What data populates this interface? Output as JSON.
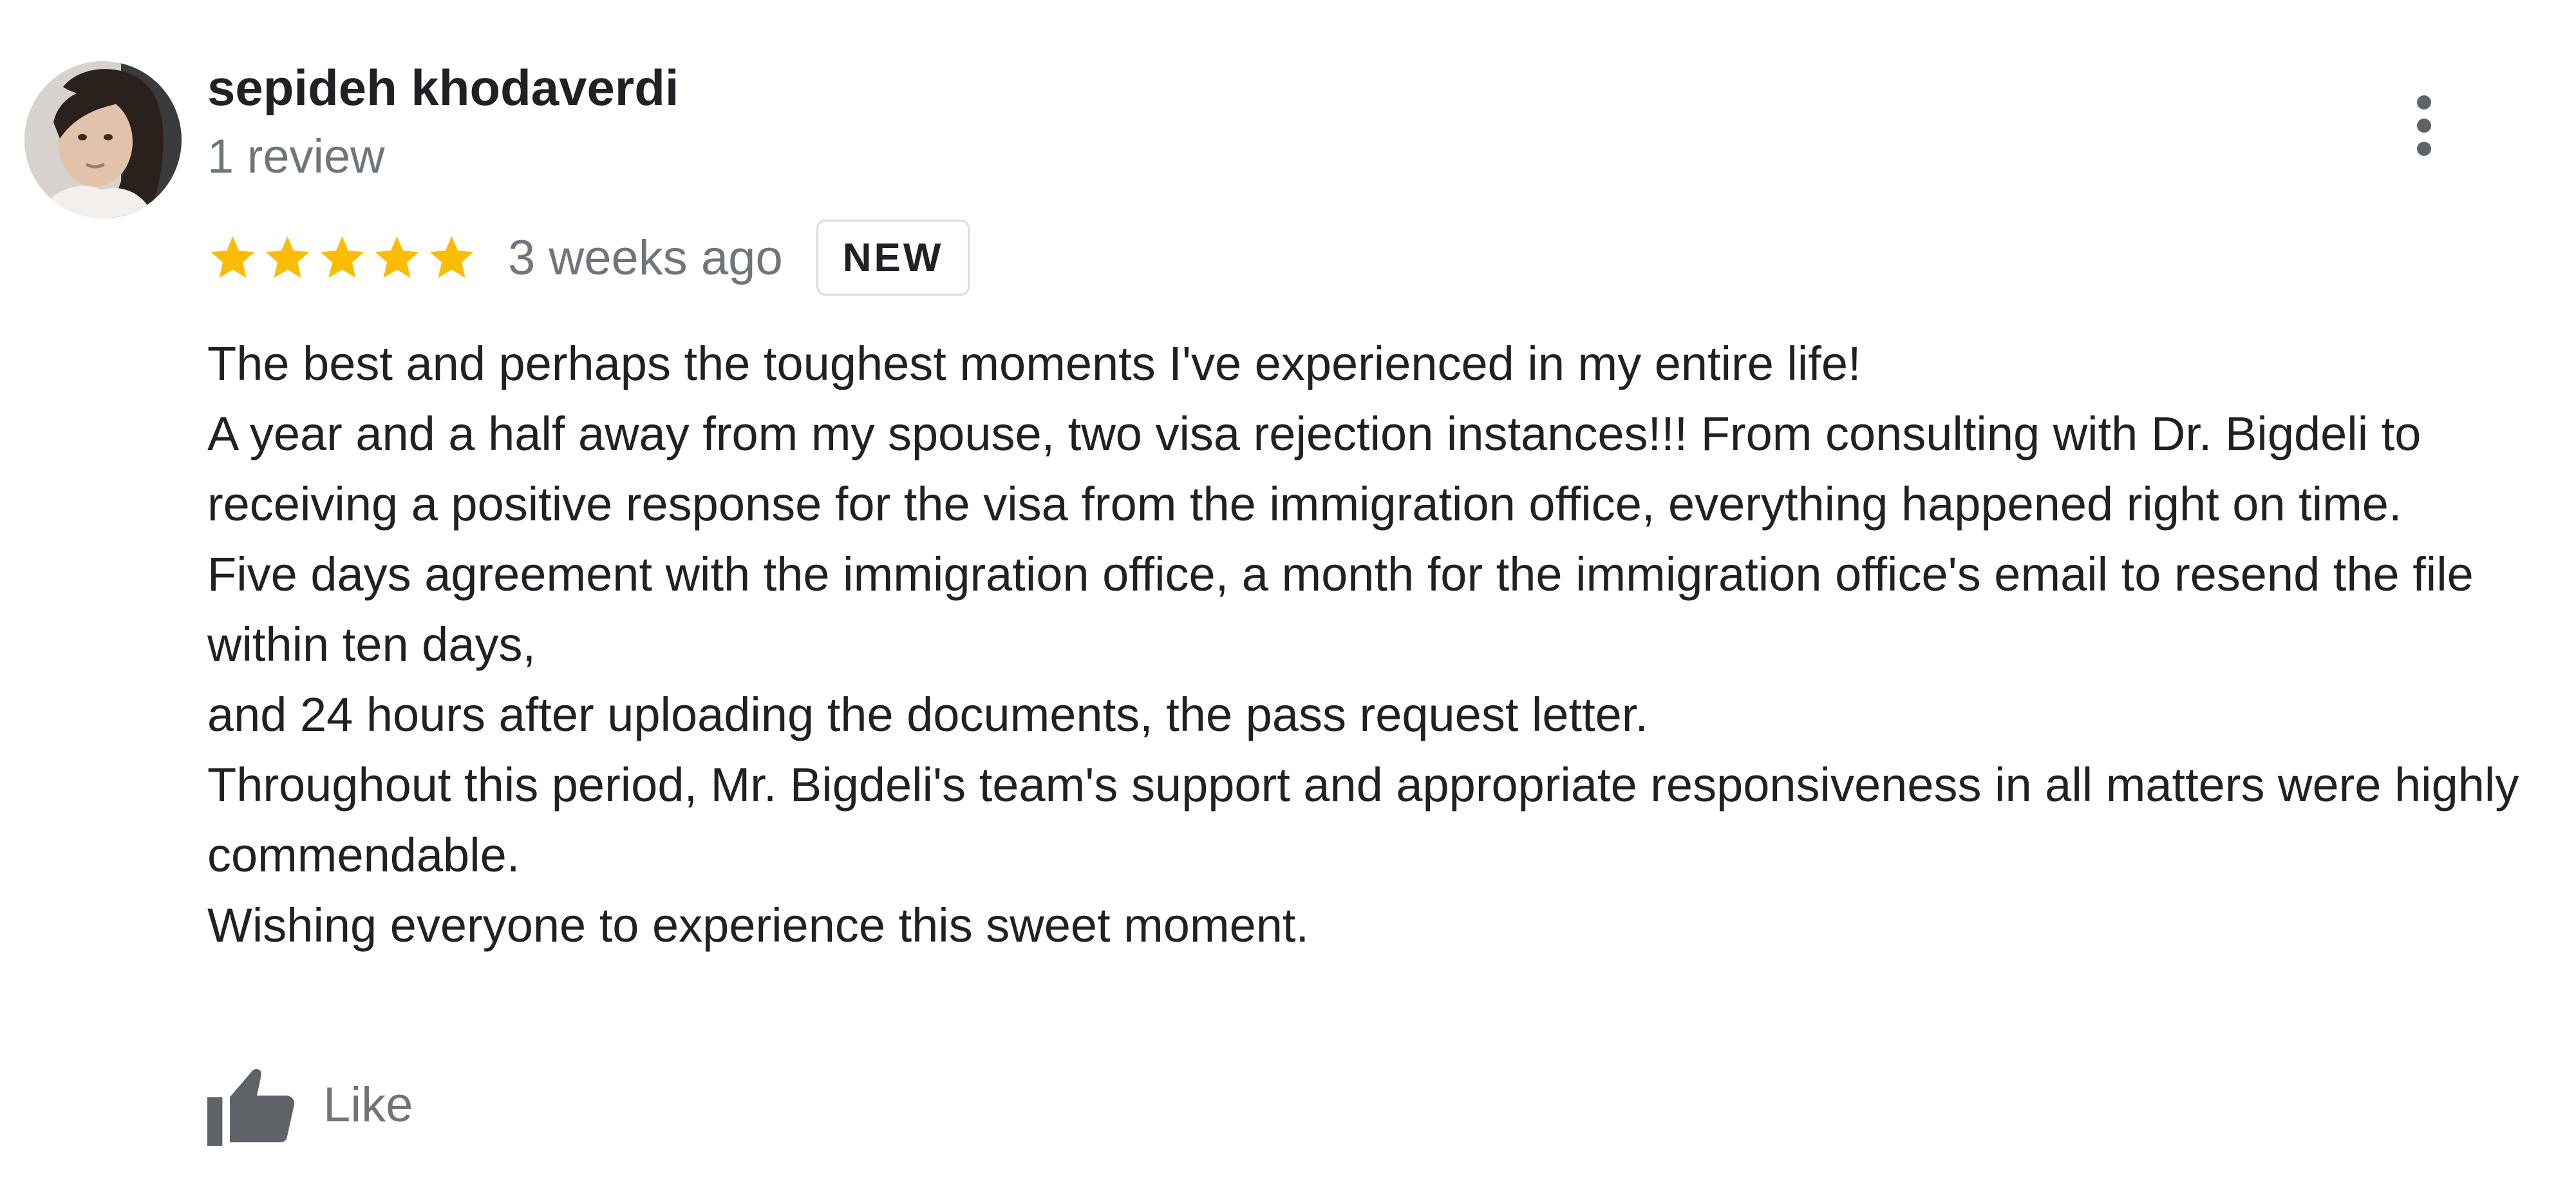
{
  "review": {
    "author_name": "sepideh khodaverdi",
    "review_count": "1 review",
    "rating": 5,
    "rating_max": 5,
    "time": "3 weeks ago",
    "badge": "NEW",
    "paragraphs": [
      "The best and perhaps the toughest moments I've experienced in my entire life!",
      "A year and a half away from my spouse, two visa rejection instances!!! From consulting with Dr. Bigdeli to receiving a positive response for the visa from the immigration office, everything happened right on time.",
      "Five days agreement with the immigration office, a month for the immigration office's email to resend the file within ten days,",
      "and 24 hours after uploading the documents, the pass request letter.",
      "Throughout this period, Mr. Bigdeli's team's support and appropriate responsiveness in all matters were highly commendable.",
      "Wishing everyone to experience this sweet moment."
    ],
    "like_label": "Like"
  },
  "icons": {
    "avatar": "user-avatar-photo",
    "more": "more-vertical-icon",
    "star": "star-icon",
    "like": "thumbs-up-icon"
  },
  "colors": {
    "star": "#fbbc04",
    "text_primary": "#202124",
    "text_secondary": "#70757a",
    "icon_gray": "#5f6368",
    "badge_border": "#dadce0"
  }
}
